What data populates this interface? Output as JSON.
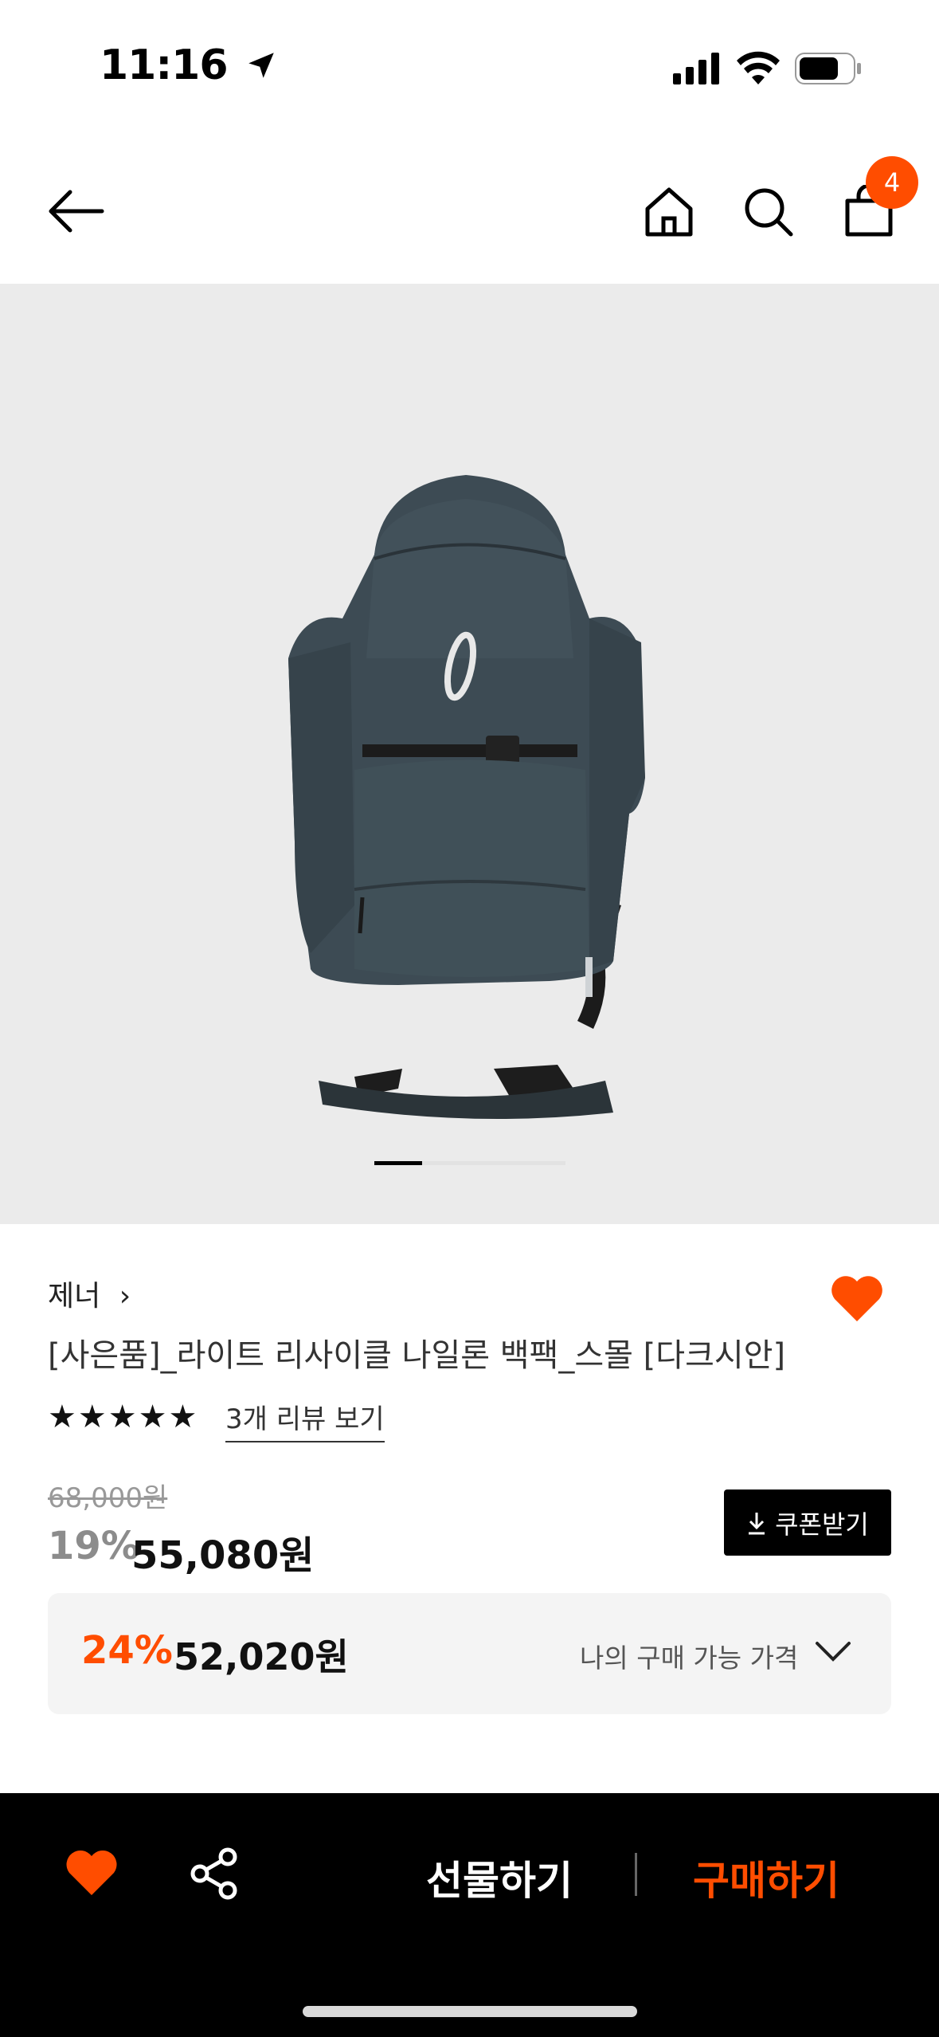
{
  "status_bar": {
    "time": "11:16"
  },
  "header": {
    "cart_count": "4"
  },
  "icons": {
    "back": "arrow-left-icon",
    "home": "home-icon",
    "search": "search-icon",
    "cart": "shopping-bag-icon",
    "wishlist": "heart-icon",
    "share": "share-icon",
    "coupon": "download-icon",
    "expand": "chevron-down-icon"
  },
  "gallery": {
    "current_index": 1,
    "total": 4
  },
  "product": {
    "brand": "제너",
    "brand_chevron": "›",
    "title": "[사은품]_라이트 리사이클 나일론 백팩_스몰 [다크시안]",
    "rating_stars": "★★★★★",
    "rating": 5,
    "review_link": "3개 리뷰 보기",
    "original_price": "68,000원",
    "discount_rate": "19%",
    "sale_price": "55,080원",
    "coupon_label": "쿠폰받기"
  },
  "my_price": {
    "rate": "24%",
    "price": "52,020원",
    "label": "나의 구매 가능 가격"
  },
  "bottom_bar": {
    "gift_label": "선물하기",
    "buy_label": "구매하기"
  },
  "colors": {
    "accent": "#ff4d00",
    "hero_bg": "#ebebeb",
    "bag": "#3d4b54"
  }
}
